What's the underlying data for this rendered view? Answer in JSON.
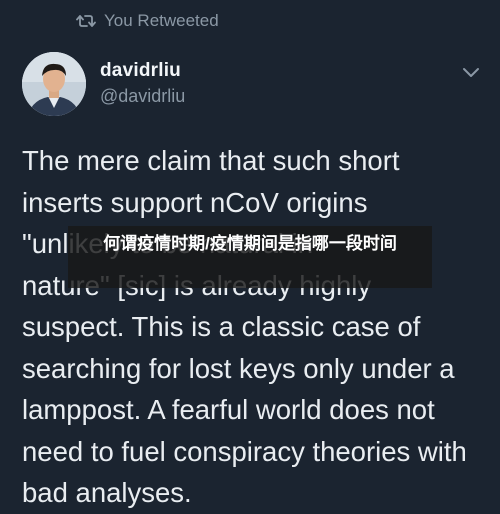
{
  "retweet": {
    "icon": "retweet-icon",
    "label": "You Retweeted"
  },
  "author": {
    "display_name": "davidrliu",
    "handle": "@davidrliu"
  },
  "menu": {
    "icon": "chevron-down-icon"
  },
  "tweet": {
    "text": "The mere claim that such short\ninserts support nCoV origins\n\"unlikely to be natural in\nnature\" [sic] is already highly\nsuspect. This is a classic case of\nsearching for lost keys only under a\nlamppost. A fearful world does not\nneed to fuel conspiracy theories with\nbad analyses."
  },
  "overlay": {
    "text": "何谓疫情时期/疫情期间是指哪一段时间"
  },
  "colors": {
    "background": "#1b2430",
    "secondary_text": "#8b98a5",
    "primary_text": "#e9edf1"
  }
}
